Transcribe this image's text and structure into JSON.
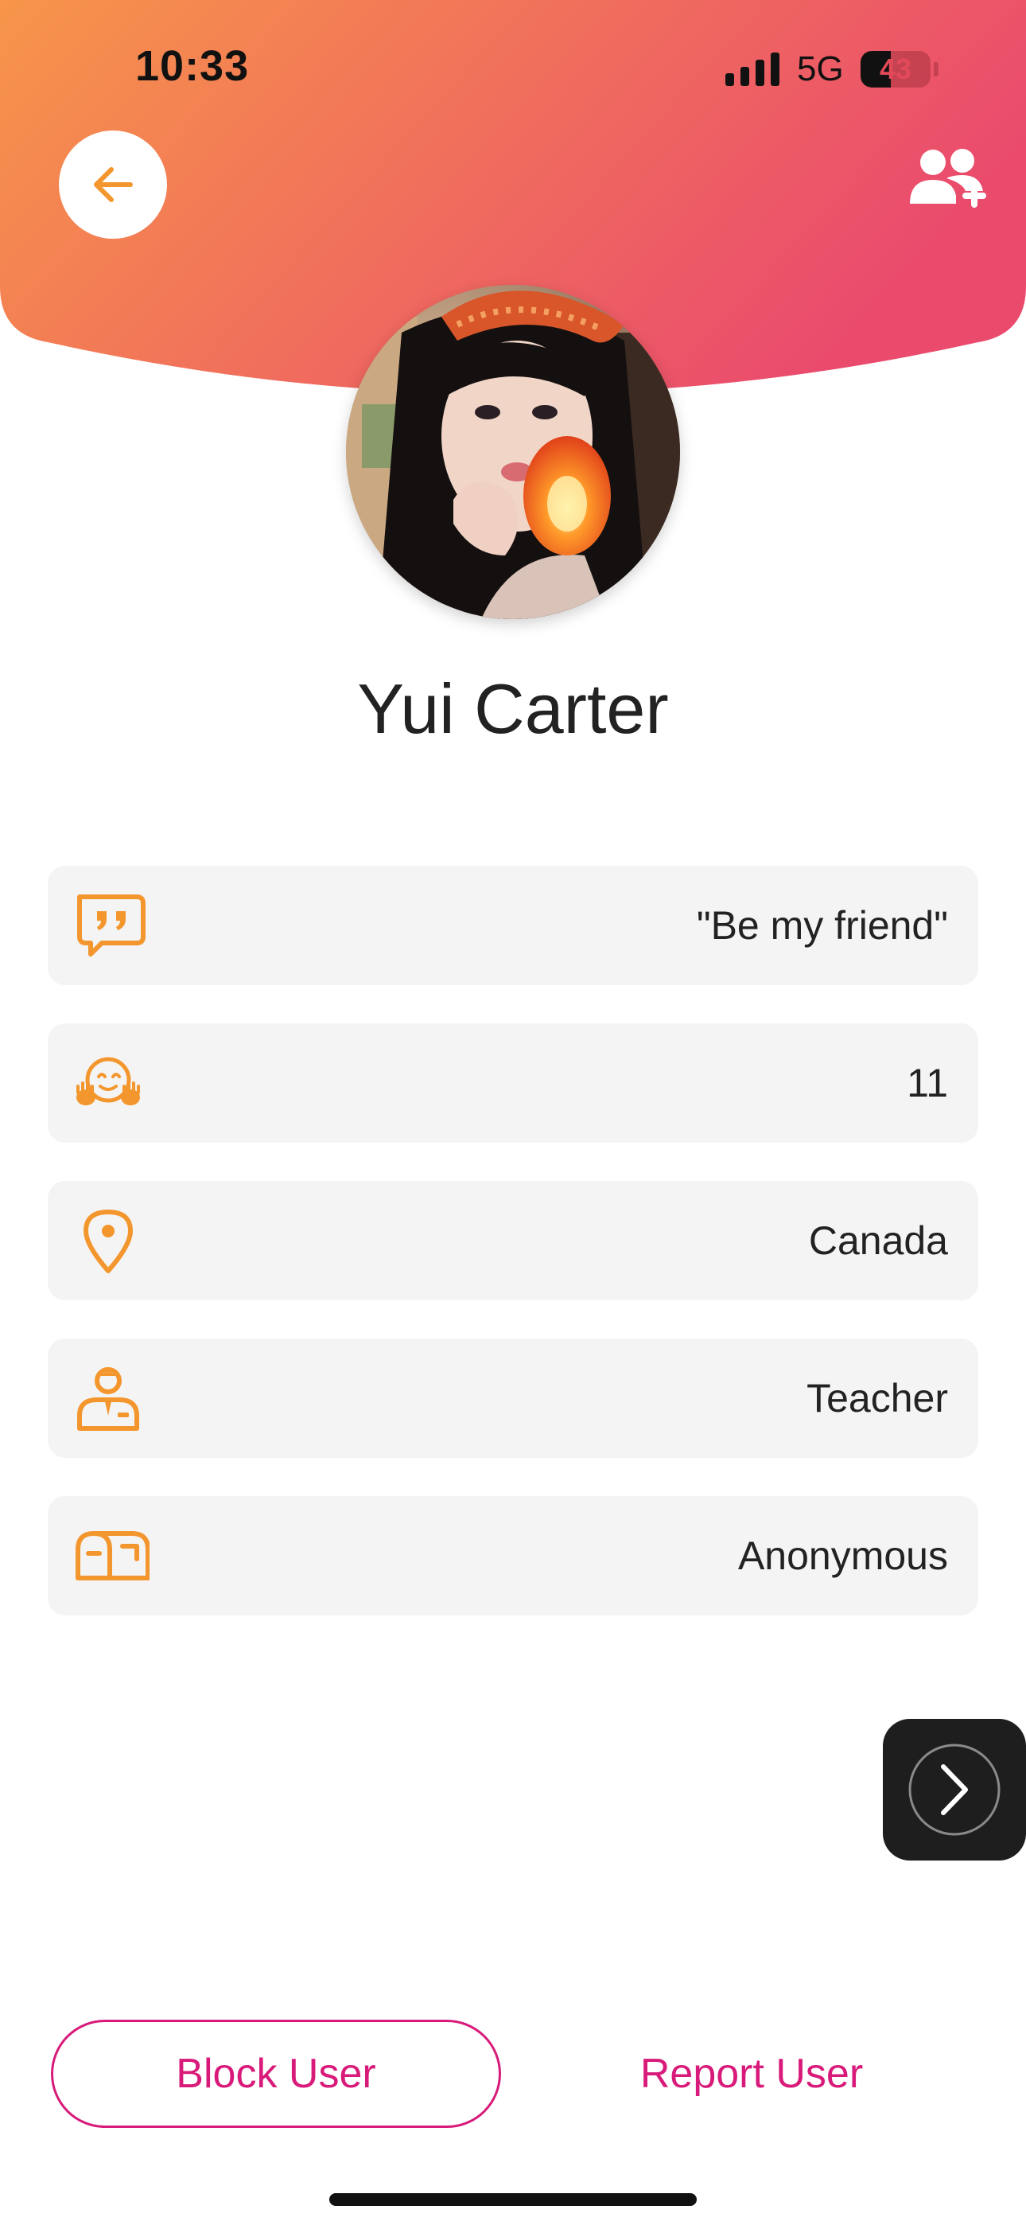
{
  "status_bar": {
    "time": "10:33",
    "network": "5G",
    "battery": "43",
    "battery_level": 0.43
  },
  "header": {
    "back_icon": "arrow-left-icon",
    "add_friend_icon": "add-user-group-icon"
  },
  "profile": {
    "name": "Yui Carter",
    "avatar": "profile-photo"
  },
  "info": {
    "items": [
      {
        "icon": "quote-bubble-icon",
        "value": "\"Be my friend\""
      },
      {
        "icon": "hug-face-icon",
        "value": "11"
      },
      {
        "icon": "location-pin-icon",
        "value": "Canada"
      },
      {
        "icon": "person-tie-icon",
        "value": "Teacher"
      },
      {
        "icon": "mailbox-icon",
        "value": "Anonymous"
      }
    ]
  },
  "actions": {
    "next_icon": "chevron-right-circle-icon",
    "block_label": "Block User",
    "report_label": "Report User"
  },
  "colors": {
    "header_gradient_start": "#f7954a",
    "header_gradient_end": "#ea4b6d",
    "icon_accent": "#f3962e",
    "action_pink": "#d81b7a"
  }
}
